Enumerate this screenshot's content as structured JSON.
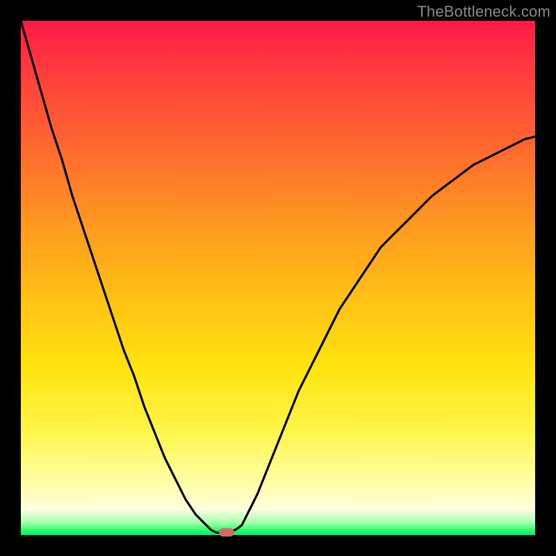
{
  "watermark": "TheBottleneck.com",
  "colors": {
    "background": "#000000",
    "gradient_top": "#ff1a48",
    "gradient_mid": "#ffe40f",
    "gradient_bottom": "#00e676",
    "curve": "#000000",
    "marker": "#d36a6a"
  },
  "chart_data": {
    "type": "line",
    "title": "",
    "xlabel": "",
    "ylabel": "",
    "xlim": [
      0,
      100
    ],
    "ylim": [
      0,
      100
    ],
    "x": [
      0,
      2,
      4,
      6,
      8,
      10,
      12,
      14,
      16,
      18,
      20,
      22,
      24,
      26,
      28,
      30,
      32,
      34,
      36,
      37,
      38,
      39,
      40,
      41,
      42,
      43,
      44,
      46,
      48,
      50,
      52,
      54,
      56,
      58,
      60,
      62,
      64,
      66,
      68,
      70,
      72,
      74,
      76,
      78,
      80,
      82,
      84,
      86,
      88,
      90,
      92,
      94,
      96,
      98,
      100
    ],
    "y": [
      100,
      93,
      86,
      79,
      73,
      66,
      60,
      54,
      48,
      42,
      36,
      31,
      25,
      20,
      15,
      11,
      7,
      4,
      2,
      1,
      0.5,
      0.5,
      0.5,
      0.7,
      1.2,
      2,
      4,
      8,
      13,
      18,
      23,
      28,
      32,
      36,
      40,
      44,
      47,
      50,
      53,
      56,
      58,
      60,
      62,
      64,
      66,
      67.5,
      69,
      70.5,
      72,
      73,
      74,
      75,
      76,
      77,
      77.5
    ],
    "marker": {
      "x": 40,
      "y": 0.5
    },
    "legend": null,
    "grid": false
  }
}
